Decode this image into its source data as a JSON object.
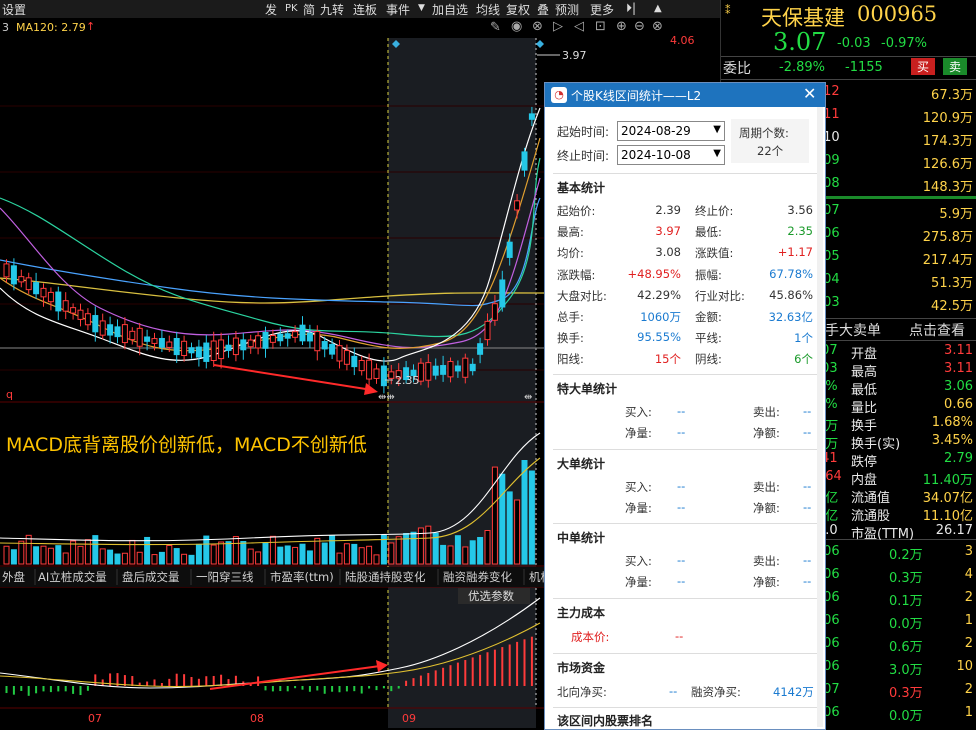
{
  "toolbar": {
    "left_label": "设置",
    "items": [
      "发",
      "PK",
      "简",
      "九转",
      "连板",
      "事件",
      "▼",
      "加自选",
      "均线",
      "复权",
      "叠",
      "预测",
      "更多"
    ],
    "ma_label": "MA120: 2.79",
    "price_label_top": "4.06"
  },
  "chart": {
    "high_label": "3.97",
    "low_label": "2.35",
    "macd_note": "MACD底背离股价创新低，MACD不创新低",
    "indicator_tabs": [
      "外盘",
      "AI立桩成交量",
      "盘后成交量",
      "一阳穿三线",
      "市盈率(ttm)",
      "陆股通持股变化",
      "融资融券变化",
      "机构"
    ],
    "optimize_label": "优选参数",
    "months": [
      "07",
      "08",
      "09"
    ],
    "corner_label": "3",
    "q_label": "q"
  },
  "stock": {
    "name": "天保基建",
    "code": "000965",
    "price": "3.07",
    "change": "-0.03",
    "change_pct": "-0.97%",
    "weibi_label": "委比",
    "weibi": "-2.89%",
    "weicha": "-1155",
    "buy_btn": "买",
    "sell_btn": "卖"
  },
  "orderbook": {
    "sell": [
      {
        "price": ".12",
        "vol": "67.3万",
        "price_color": "red"
      },
      {
        "price": ".11",
        "vol": "120.9万",
        "price_color": "red"
      },
      {
        "price": ".10",
        "vol": "174.3万",
        "price_color": "white"
      },
      {
        "price": ".09",
        "vol": "126.6万",
        "price_color": "green"
      },
      {
        "price": ".08",
        "vol": "148.3万",
        "price_color": "green"
      }
    ],
    "buy": [
      {
        "price": ".07",
        "vol": "5.9万"
      },
      {
        "price": ".06",
        "vol": "275.8万"
      },
      {
        "price": ".05",
        "vol": "217.4万"
      },
      {
        "price": ".04",
        "vol": "51.3万"
      },
      {
        "price": ".03",
        "vol": "42.5万"
      }
    ]
  },
  "tabs_right": {
    "a": "手",
    "b": "大卖单",
    "c": "点击查看"
  },
  "quote": [
    {
      "lv": ".07",
      "lc": "green",
      "k": "开盘",
      "v": "3.11",
      "vc": "red"
    },
    {
      "lv": ".03",
      "lc": "green",
      "k": "最高",
      "v": "3.11",
      "vc": "red"
    },
    {
      "lv": "7%",
      "lc": "green",
      "k": "最低",
      "v": "3.06",
      "vc": "green"
    },
    {
      "lv": "1%",
      "lc": "green",
      "k": "量比",
      "v": "0.66",
      "vc": "yellow"
    },
    {
      "lv": "9万",
      "lc": "green",
      "k": "换手",
      "v": "1.68%",
      "vc": "yellow"
    },
    {
      "lv": "7万",
      "lc": "green",
      "k": "换手(实)",
      "v": "3.45%",
      "vc": "yellow"
    },
    {
      "lv": ".41",
      "lc": "red",
      "k": "跌停",
      "v": "2.79",
      "vc": "green"
    },
    {
      "lv": "064",
      "lc": "red",
      "k": "内盘",
      "v": "11.40万",
      "vc": "green"
    },
    {
      "lv": "7亿",
      "lc": "green",
      "k": "流通值",
      "v": "34.07亿",
      "vc": "yellow"
    },
    {
      "lv": "0亿",
      "lc": "green",
      "k": "流通股",
      "v": "11.10亿",
      "vc": "yellow"
    },
    {
      "lv": "0.0",
      "lc": "white",
      "k": "市盈(TTM)",
      "v": "26.17",
      "vc": "white"
    }
  ],
  "ticks": [
    {
      "p": ".06",
      "v": "0.2万",
      "n": "3",
      "vc": "green"
    },
    {
      "p": ".06",
      "v": "0.3万",
      "n": "4",
      "vc": "green"
    },
    {
      "p": ".06",
      "v": "0.1万",
      "n": "2",
      "vc": "green"
    },
    {
      "p": ".06",
      "v": "0.0万",
      "n": "1",
      "vc": "green"
    },
    {
      "p": ".06",
      "v": "0.6万",
      "n": "2",
      "vc": "green"
    },
    {
      "p": ".06",
      "v": "3.0万",
      "n": "10",
      "vc": "green"
    },
    {
      "p": ".07",
      "v": "0.3万",
      "n": "2",
      "vc": "red"
    },
    {
      "p": ".06",
      "v": "0.0万",
      "n": "1",
      "vc": "green"
    }
  ],
  "dialog": {
    "title": "个股K线区间统计——L2",
    "start_label": "起始时间:",
    "start_value": "2024-08-29",
    "end_label": "终止时间:",
    "end_value": "2024-10-08",
    "period_label": "周期个数:",
    "period_value": "22个",
    "basic_title": "基本统计",
    "basic": [
      {
        "l1": "起始价:",
        "v1": "2.39",
        "c1": "#333",
        "l2": "终止价:",
        "v2": "3.56",
        "c2": "#333"
      },
      {
        "l1": "最高:",
        "v1": "3.97",
        "c1": "#e02020",
        "l2": "最低:",
        "v2": "2.35",
        "c2": "#1a9a2a"
      },
      {
        "l1": "均价:",
        "v1": "3.08",
        "c1": "#333",
        "l2": "涨跌值:",
        "v2": "+1.17",
        "c2": "#e02020"
      },
      {
        "l1": "涨跌幅:",
        "v1": "+48.95%",
        "c1": "#e02020",
        "l2": "振幅:",
        "v2": "67.78%",
        "c2": "#1a7ad0"
      },
      {
        "l1": "大盘对比:",
        "v1": "42.29%",
        "c1": "#333",
        "l2": "行业对比:",
        "v2": "45.86%",
        "c2": "#333"
      },
      {
        "l1": "总手:",
        "v1": "1060万",
        "c1": "#1a7ad0",
        "l2": "金额:",
        "v2": "32.63亿",
        "c2": "#1a7ad0"
      },
      {
        "l1": "换手:",
        "v1": "95.55%",
        "c1": "#1a7ad0",
        "l2": "平线:",
        "v2": "1个",
        "c2": "#1a7ad0"
      },
      {
        "l1": "阳线:",
        "v1": "15个",
        "c1": "#e02020",
        "l2": "阴线:",
        "v2": "6个",
        "c2": "#1a9a2a"
      }
    ],
    "super_title": "特大单统计",
    "big_title": "大单统计",
    "mid_title": "中单统计",
    "buy_in": "买入:",
    "sell_out": "卖出:",
    "net_vol": "净量:",
    "net_amt": "净额:",
    "dash": "--",
    "cost_title": "主力成本",
    "cost_label": "成本价:",
    "cost_value": "--",
    "fund_title": "市场资金",
    "north_label": "北向净买:",
    "north_value": "--",
    "margin_label": "融资净买:",
    "margin_value": "4142万",
    "rank_title": "该区间内股票排名"
  }
}
